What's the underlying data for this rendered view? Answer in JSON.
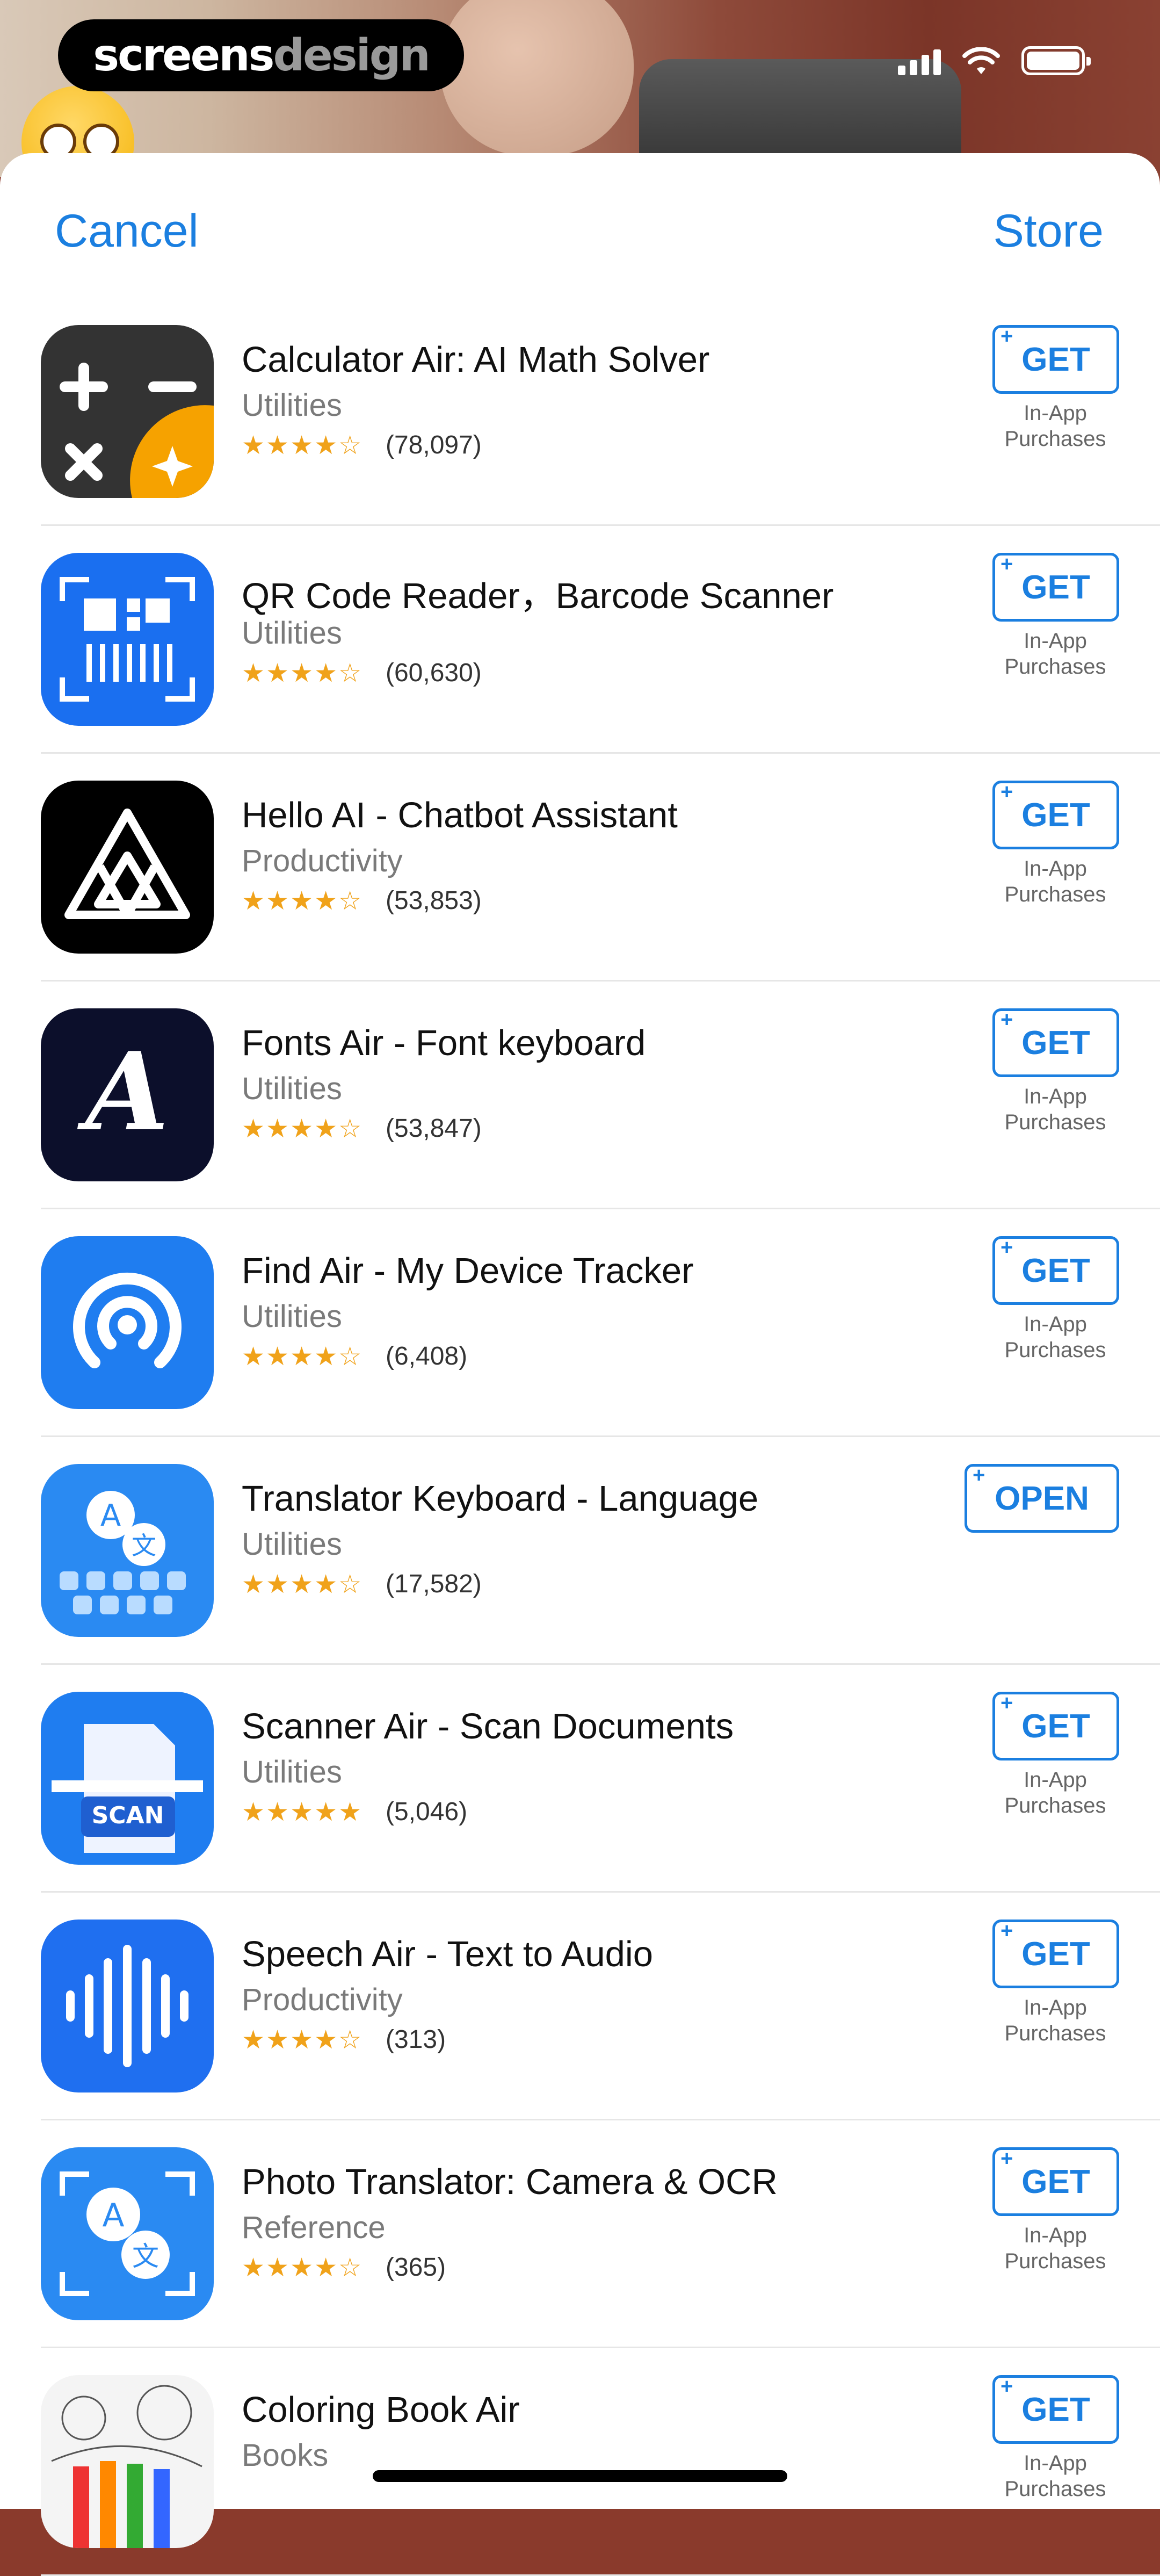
{
  "watermark": {
    "part1": "screens",
    "part2": "design"
  },
  "nav": {
    "cancel_label": "Cancel",
    "store_label": "Store"
  },
  "iap_label": [
    "In-App",
    "Purchases"
  ],
  "apps": [
    {
      "title": "Calculator Air: AI Math Solver",
      "category": "Utilities",
      "stars": "★★★★☆",
      "count": "(78,097)",
      "button": "GET",
      "iap": true,
      "icon": "calculator-icon"
    },
    {
      "title": "QR Code Reader，Barcode Scanner",
      "category": "Utilities",
      "stars": "★★★★☆",
      "count": "(60,630)",
      "button": "GET",
      "iap": true,
      "icon": "qr-code-icon"
    },
    {
      "title": "Hello AI - Chatbot Assistant",
      "category": "Productivity",
      "stars": "★★★★☆",
      "count": "(53,853)",
      "button": "GET",
      "iap": true,
      "icon": "triangle-logo-icon"
    },
    {
      "title": "Fonts Air - Font keyboard",
      "category": "Utilities",
      "stars": "★★★★☆",
      "count": "(53,847)",
      "button": "GET",
      "iap": true,
      "icon": "font-letter-icon"
    },
    {
      "title": "Find Air - My Device Tracker",
      "category": "Utilities",
      "stars": "★★★★☆",
      "count": "(6,408)",
      "button": "GET",
      "iap": true,
      "icon": "tracker-signal-icon"
    },
    {
      "title": "Translator Keyboard - Language",
      "category": "Utilities",
      "stars": "★★★★☆",
      "count": "(17,582)",
      "button": "OPEN",
      "iap": false,
      "icon": "translate-keyboard-icon"
    },
    {
      "title": "Scanner Air - Scan Documents",
      "category": "Utilities",
      "stars": "★★★★★",
      "count": "(5,046)",
      "button": "GET",
      "iap": true,
      "icon": "scan-document-icon"
    },
    {
      "title": "Speech Air - Text to Audio",
      "category": "Productivity",
      "stars": "★★★★☆",
      "count": "(313)",
      "button": "GET",
      "iap": true,
      "icon": "audio-wave-icon"
    },
    {
      "title": "Photo Translator: Camera & OCR",
      "category": "Reference",
      "stars": "★★★★☆",
      "count": "(365)",
      "button": "GET",
      "iap": true,
      "icon": "photo-translate-icon"
    },
    {
      "title": "Coloring Book Air",
      "category": "Books",
      "stars": "",
      "count": "",
      "button": "GET",
      "iap": true,
      "icon": "coloring-pencils-icon"
    }
  ]
}
